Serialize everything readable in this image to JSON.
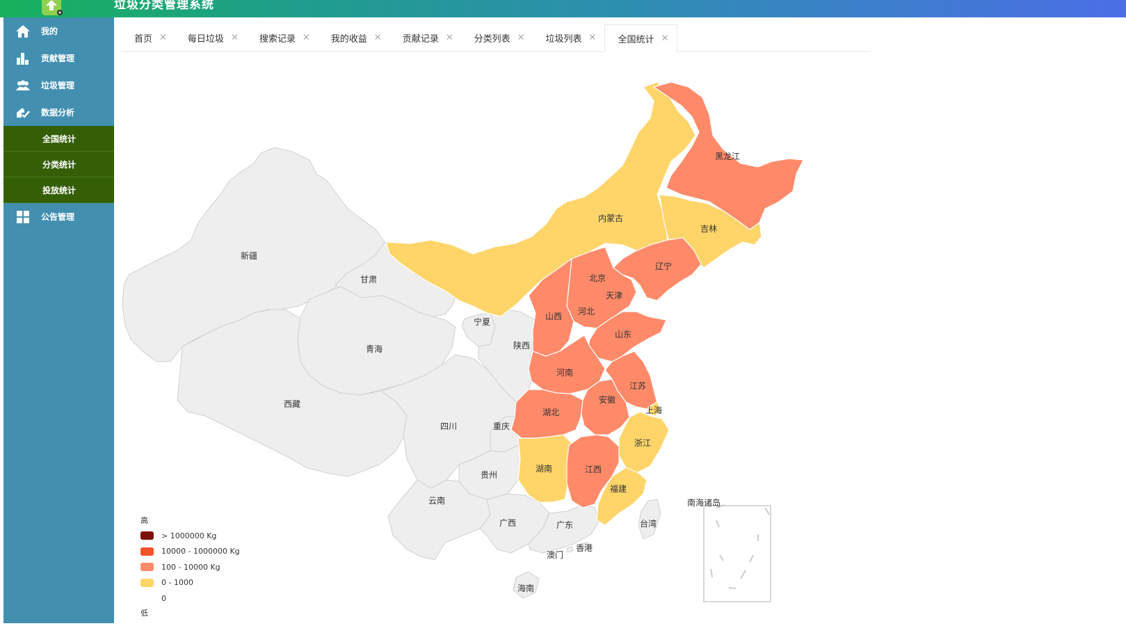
{
  "app": {
    "title": "垃圾分类管理系统"
  },
  "sidebar": {
    "items": [
      {
        "label": "我的",
        "icon": "home-icon"
      },
      {
        "label": "贡献管理",
        "icon": "bar-chart-icon"
      },
      {
        "label": "垃圾管理",
        "icon": "users-icon"
      },
      {
        "label": "数据分析",
        "icon": "analysis-icon"
      }
    ],
    "submenu": [
      {
        "label": "全国统计"
      },
      {
        "label": "分类统计"
      },
      {
        "label": "投放统计"
      }
    ],
    "items_after": [
      {
        "label": "公告管理",
        "icon": "grid-icon"
      }
    ]
  },
  "tabs": [
    {
      "label": "首页"
    },
    {
      "label": "每日垃圾"
    },
    {
      "label": "搜索记录"
    },
    {
      "label": "我的收益"
    },
    {
      "label": "贡献记录"
    },
    {
      "label": "分类列表"
    },
    {
      "label": "垃圾列表"
    },
    {
      "label": "全国统计",
      "active": true
    }
  ],
  "map": {
    "legend": {
      "high_label": "高",
      "low_label": "低",
      "ranges": [
        {
          "label": "> 1000000 Kg",
          "color": "#7d1009"
        },
        {
          "label": "10000 - 1000000 Kg",
          "color": "#f4532b"
        },
        {
          "label": "100 - 10000 Kg",
          "color": "#ff8a6a"
        },
        {
          "label": "0 - 1000",
          "color": "#ffd56a"
        },
        {
          "label": "0",
          "color": "#ffffff"
        }
      ]
    },
    "colors": {
      "none": "#eeeeee",
      "mid": "#ff8a6a",
      "low": "#ffd56a",
      "border": "#d0d0d0"
    },
    "regions": [
      {
        "name": "新疆",
        "level": "none"
      },
      {
        "name": "甘肃",
        "level": "none"
      },
      {
        "name": "青海",
        "level": "none"
      },
      {
        "name": "西藏",
        "level": "none"
      },
      {
        "name": "四川",
        "level": "none"
      },
      {
        "name": "宁夏",
        "level": "none"
      },
      {
        "name": "陕西",
        "level": "none"
      },
      {
        "name": "重庆",
        "level": "none"
      },
      {
        "name": "贵州",
        "level": "none"
      },
      {
        "name": "云南",
        "level": "none"
      },
      {
        "name": "广西",
        "level": "none"
      },
      {
        "name": "广东",
        "level": "none"
      },
      {
        "name": "海南",
        "level": "none"
      },
      {
        "name": "香港",
        "level": "none"
      },
      {
        "name": "澳门",
        "level": "none"
      },
      {
        "name": "台湾",
        "level": "none"
      },
      {
        "name": "南海诸岛",
        "level": "none"
      },
      {
        "name": "内蒙古",
        "level": "low"
      },
      {
        "name": "吉林",
        "level": "low"
      },
      {
        "name": "北京",
        "level": "low"
      },
      {
        "name": "天津",
        "level": "low"
      },
      {
        "name": "上海",
        "level": "low"
      },
      {
        "name": "浙江",
        "level": "low"
      },
      {
        "name": "湖南",
        "level": "low"
      },
      {
        "name": "福建",
        "level": "low"
      },
      {
        "name": "黑龙江",
        "level": "mid"
      },
      {
        "name": "辽宁",
        "level": "mid"
      },
      {
        "name": "河北",
        "level": "mid"
      },
      {
        "name": "山西",
        "level": "mid"
      },
      {
        "name": "山东",
        "level": "mid"
      },
      {
        "name": "河南",
        "level": "mid"
      },
      {
        "name": "江苏",
        "level": "mid"
      },
      {
        "name": "安徽",
        "level": "mid"
      },
      {
        "name": "湖北",
        "level": "mid"
      },
      {
        "name": "江西",
        "level": "mid"
      }
    ]
  }
}
